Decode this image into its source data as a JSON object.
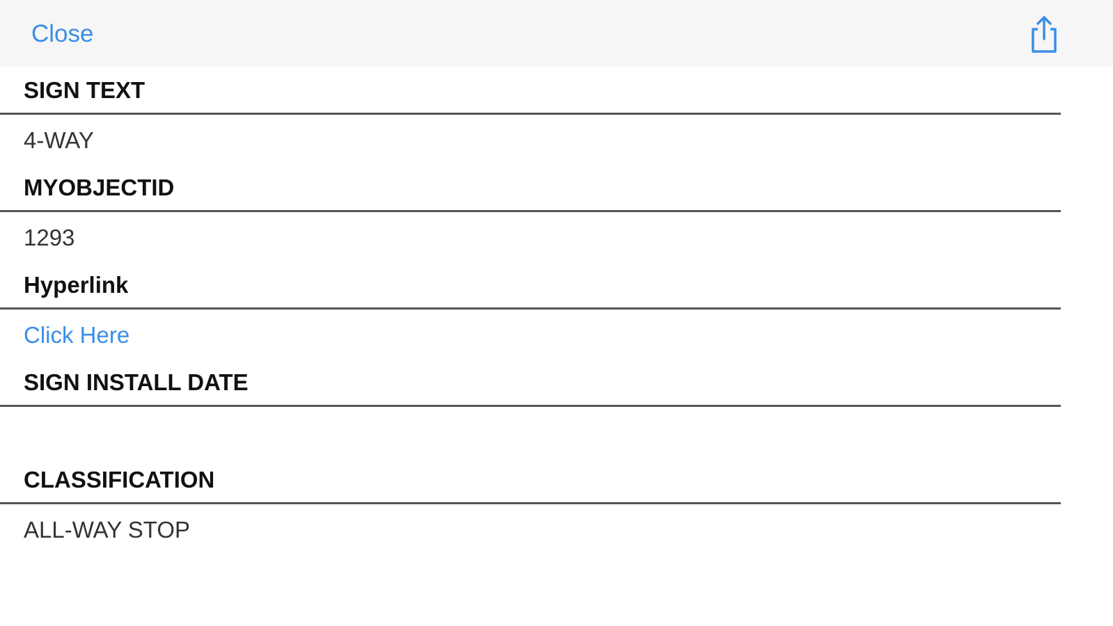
{
  "navbar": {
    "close_label": "Close",
    "share_icon": "share-icon",
    "accent_color": "#3a8ee6"
  },
  "fields": [
    {
      "label": "SIGN TEXT",
      "value": "4-WAY"
    },
    {
      "label": "MYOBJECTID",
      "value": "1293"
    },
    {
      "label": "Hyperlink",
      "value": "Click Here"
    },
    {
      "label": "SIGN INSTALL DATE",
      "value": ""
    },
    {
      "label": "CLASSIFICATION",
      "value": "ALL-WAY STOP"
    }
  ]
}
